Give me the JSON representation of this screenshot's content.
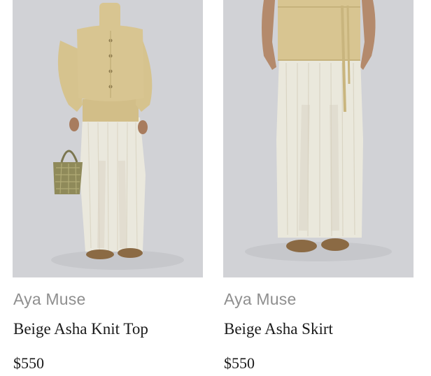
{
  "products": [
    {
      "brand": "Aya Muse",
      "name": "Beige Asha Knit Top",
      "price": "$550"
    },
    {
      "brand": "Aya Muse",
      "name": "Beige Asha Skirt",
      "price": "$550"
    }
  ],
  "colors": {
    "image_background": "#d1d2d6",
    "knit": "#d8c591",
    "sheer_skirt": "#efece0",
    "brand_text": "#8f8f8f",
    "title_text": "#1a1a1a"
  }
}
